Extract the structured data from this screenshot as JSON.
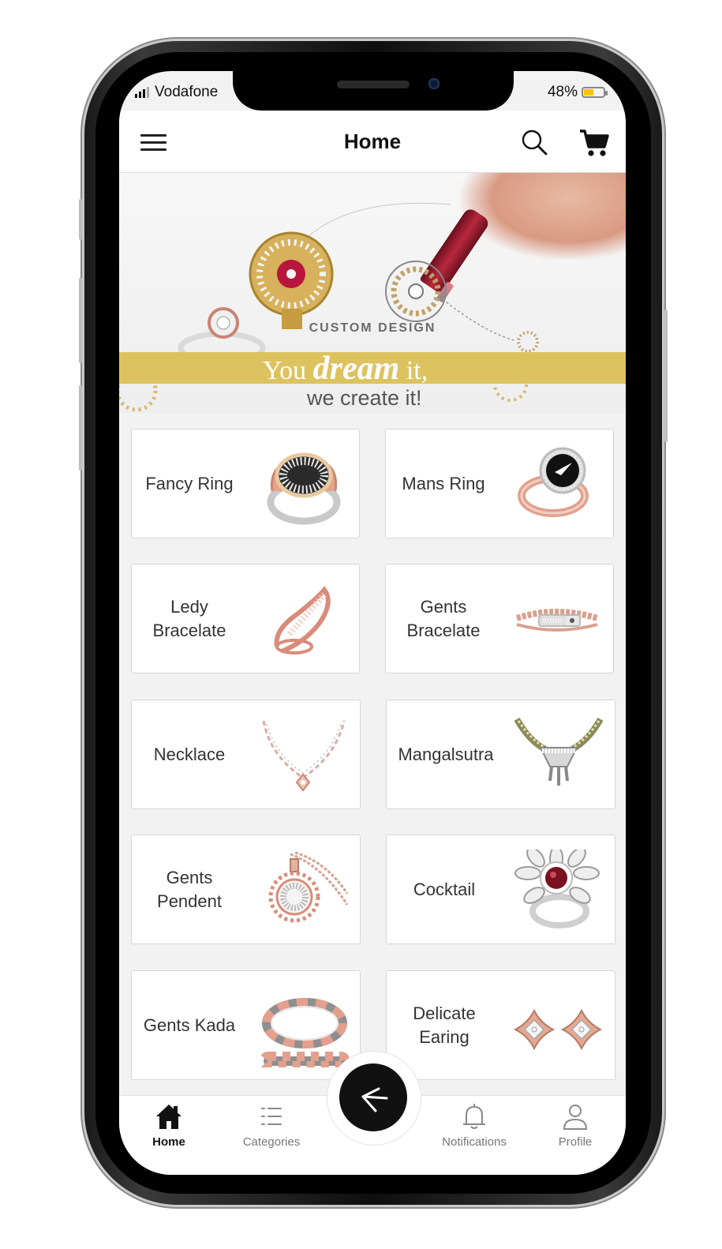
{
  "status_bar": {
    "carrier": "Vodafone",
    "battery": "48%",
    "battery_level": 0.48
  },
  "header": {
    "title": "Home",
    "menu_icon": "hamburger-menu-icon",
    "search_icon": "search-icon",
    "cart_icon": "shopping-cart-icon"
  },
  "banner": {
    "caption": "CUSTOM DESIGN",
    "slogan_you": "You",
    "slogan_dream": "dream",
    "slogan_it": "it,",
    "slogan_line2": "we create it!"
  },
  "categories": [
    {
      "label": "Fancy Ring"
    },
    {
      "label": "Mans Ring"
    },
    {
      "label": "Ledy\nBracelate"
    },
    {
      "label": "Gents\nBracelate"
    },
    {
      "label": "Necklace"
    },
    {
      "label": "Mangalsutra"
    },
    {
      "label": "Gents\nPendent"
    },
    {
      "label": "Cocktail"
    },
    {
      "label": "Gents Kada"
    },
    {
      "label": "Delicate\nEaring"
    }
  ],
  "bottom_nav": {
    "home": "Home",
    "categories": "Categories",
    "notifications": "Notifications",
    "profile": "Profile"
  },
  "colors": {
    "accent_gold": "#dcc35f",
    "rose_gold": "#d98c7a",
    "fab": "#111111"
  }
}
